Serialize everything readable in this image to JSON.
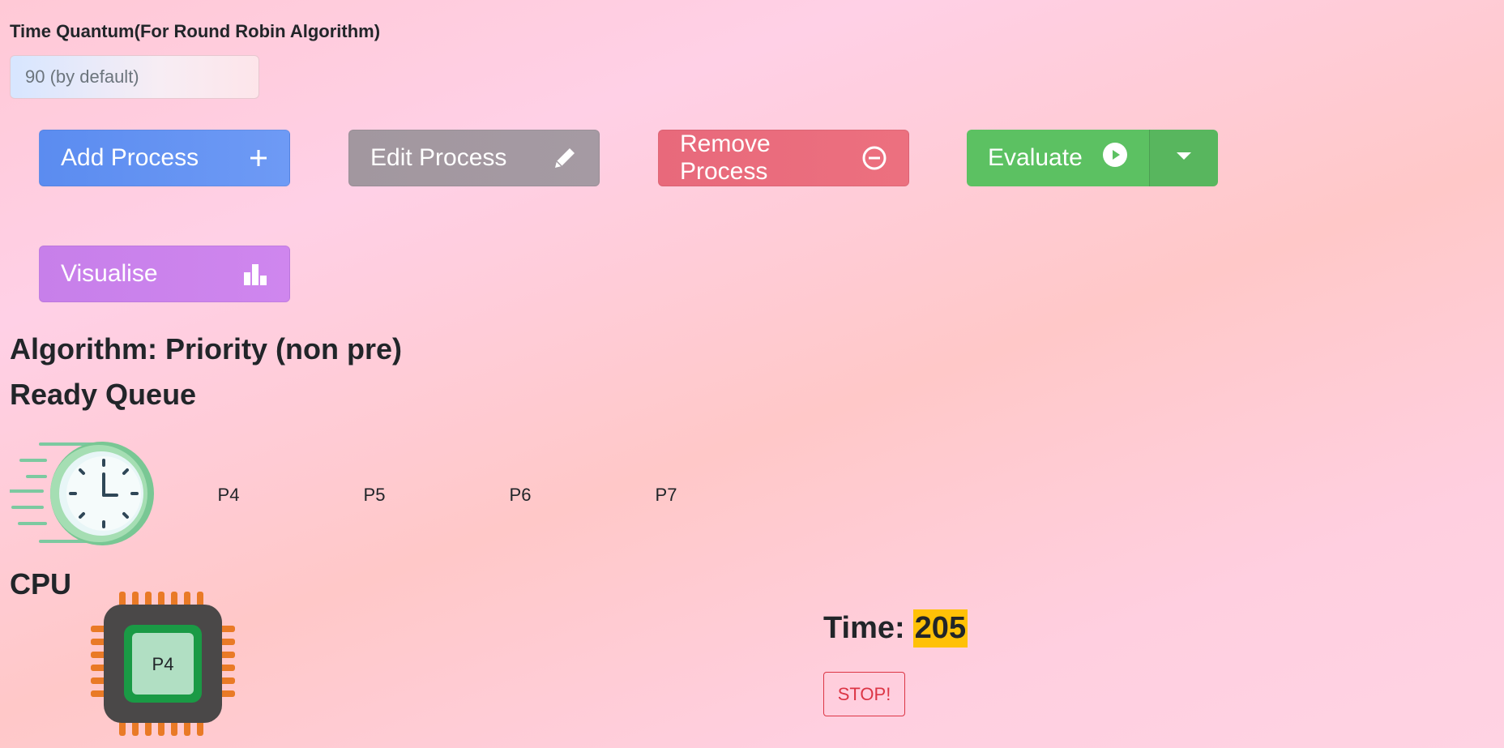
{
  "time_quantum": {
    "label": "Time Quantum(For Round Robin Algorithm)",
    "placeholder": "90 (by default)"
  },
  "toolbar": {
    "add_label": "Add Process",
    "edit_label": "Edit Process",
    "remove_label": "Remove Process",
    "evaluate_label": "Evaluate",
    "visualise_label": "Visualise"
  },
  "algorithm_heading": "Algorithm: Priority (non pre)",
  "ready_queue": {
    "heading": "Ready Queue",
    "items": [
      "P4",
      "P5",
      "P6",
      "P7"
    ]
  },
  "cpu": {
    "heading": "CPU",
    "current_process": "P4"
  },
  "timer": {
    "label": "Time:",
    "value": "205",
    "stop_label": "STOP!"
  },
  "icons": {
    "add": "plus-icon",
    "edit": "pencil-icon",
    "remove": "minus-circle-icon",
    "evaluate": "play-circle-icon",
    "dropdown": "caret-down-icon",
    "visualise": "bar-chart-icon",
    "queue": "fast-clock-icon",
    "cpu": "cpu-chip-icon"
  },
  "colors": {
    "add": "#6392f2",
    "edit": "#a3989f",
    "remove": "#ea6c7d",
    "evaluate": "#5cc162",
    "visualise": "#cb82ec",
    "time_highlight": "#ffc107",
    "stop": "#dc3545"
  }
}
